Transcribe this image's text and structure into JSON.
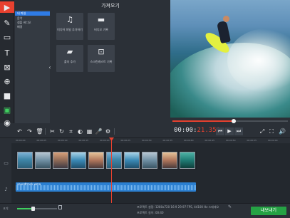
{
  "panel": {
    "title": "가져오기"
  },
  "categories": [
    {
      "label": "내 파일",
      "selected": true
    },
    {
      "label": "음악"
    },
    {
      "label": "샘플 비디오"
    },
    {
      "label": "배경"
    }
  ],
  "tiles": [
    {
      "label": "미디어 파일 추가하기",
      "icon": "media-file-icon"
    },
    {
      "label": "비디오 기록",
      "icon": "video-camera-icon"
    },
    {
      "label": "폴더 추가",
      "icon": "folder-icon"
    },
    {
      "label": "스크린캐스트 기록",
      "icon": "screencast-icon"
    }
  ],
  "player": {
    "timecode_main": "00:00:",
    "timecode_red": "21.350",
    "progress_fraction": 0.53
  },
  "timeline": {
    "ticks": [
      "00:00:00",
      "00:00:05",
      "00:00:10",
      "00:00:15",
      "00:00:20",
      "00:00:25",
      "00:00:30",
      "00:00:35",
      "00:00:40",
      "00:00:45",
      "00:00:50",
      "00:00:55",
      "00:01:00"
    ],
    "audio_clip": "soundtrack.wma"
  },
  "status": {
    "zoom_label": "크기:",
    "project_settings": "프로젝트 설정:  1280x720 16:9 29.97 FPS, 44100 Hz 스테레오",
    "project_length": "프로젝트 길이: 00:40",
    "export_label": "내보내기"
  },
  "colors": {
    "accent": "#e8412f",
    "selection": "#2f7ce6",
    "export": "#25a244"
  }
}
